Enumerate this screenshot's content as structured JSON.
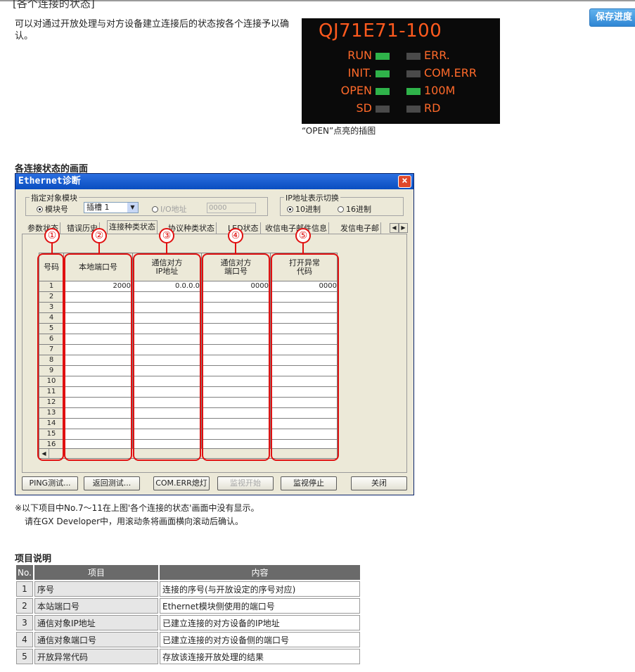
{
  "header": {
    "section_title": "[各个连接的状态]",
    "intro": "可以对通过开放处理与对方设备建立连接后的状态按各个连接予以确认。",
    "save_button": "保存进度"
  },
  "led_panel": {
    "model": "QJ71E71-100",
    "leds": [
      {
        "label": "RUN",
        "state": "on",
        "side": "left"
      },
      {
        "label": "ERR.",
        "state": "off",
        "side": "right"
      },
      {
        "label": "INIT.",
        "state": "on",
        "side": "left"
      },
      {
        "label": "COM.ERR",
        "state": "off",
        "side": "right"
      },
      {
        "label": "OPEN",
        "state": "on",
        "side": "left"
      },
      {
        "label": "100M",
        "state": "on",
        "side": "right"
      },
      {
        "label": "SD",
        "state": "off",
        "side": "left"
      },
      {
        "label": "RD",
        "state": "off",
        "side": "right"
      }
    ],
    "caption": "“OPEN”点亮的插图"
  },
  "screen_title": "各连接状态的画面",
  "dialog": {
    "title": "Ethernet诊断",
    "close": "×",
    "target_group": {
      "label": "指定对象模块",
      "radio_module": "模块号",
      "slot_value": "插槽 1",
      "radio_io": "I/O地址",
      "io_value": "0000"
    },
    "ip_group": {
      "label": "IP地址表示切换",
      "radio_dec": "10进制",
      "radio_hex": "16进制"
    },
    "tabs": [
      "参数状态",
      "错误历史",
      "连接种类状态",
      "协议种类状态",
      "LED状态",
      "收信电子邮件信息",
      "发信电子邮"
    ],
    "active_tab": 2,
    "columns": [
      {
        "header": "号码"
      },
      {
        "header": "本地端口号"
      },
      {
        "header": "通信对方\nIP地址"
      },
      {
        "header": "通信对方\n端口号"
      },
      {
        "header": "打开异常\n代码"
      }
    ],
    "rows": [
      [
        "1",
        "2000",
        "0.0.0.0",
        "0000",
        "0000"
      ],
      [
        "2",
        "",
        "",
        "",
        ""
      ],
      [
        "3",
        "",
        "",
        "",
        ""
      ],
      [
        "4",
        "",
        "",
        "",
        ""
      ],
      [
        "5",
        "",
        "",
        "",
        ""
      ],
      [
        "6",
        "",
        "",
        "",
        ""
      ],
      [
        "7",
        "",
        "",
        "",
        ""
      ],
      [
        "8",
        "",
        "",
        "",
        ""
      ],
      [
        "9",
        "",
        "",
        "",
        ""
      ],
      [
        "10",
        "",
        "",
        "",
        ""
      ],
      [
        "11",
        "",
        "",
        "",
        ""
      ],
      [
        "12",
        "",
        "",
        "",
        ""
      ],
      [
        "13",
        "",
        "",
        "",
        ""
      ],
      [
        "14",
        "",
        "",
        "",
        ""
      ],
      [
        "15",
        "",
        "",
        "",
        ""
      ],
      [
        "16",
        "",
        "",
        "",
        ""
      ]
    ],
    "callouts": [
      "①",
      "②",
      "③",
      "④",
      "⑤"
    ],
    "buttons": [
      {
        "label": "PING测试...",
        "enabled": true
      },
      {
        "label": "返回测试...",
        "enabled": true
      },
      {
        "label": "COM.ERR熄灯",
        "enabled": true
      },
      {
        "label": "监视开始",
        "enabled": false
      },
      {
        "label": "监视停止",
        "enabled": true
      },
      {
        "label": "关闭",
        "enabled": true
      }
    ]
  },
  "note": {
    "line1": "※以下项目中No.7～11在上图'各个连接的状态'画面中没有显示。",
    "line2": "请在GX Developer中，用滚动条将画面横向滚动后确认。"
  },
  "items_table": {
    "title": "项目说明",
    "headers": [
      "No.",
      "项目",
      "内容"
    ],
    "rows": [
      [
        "1",
        "序号",
        "连接的序号(与开放设定的序号对应)"
      ],
      [
        "2",
        "本站端口号",
        "Ethernet模块侧使用的端口号"
      ],
      [
        "3",
        "通信对象IP地址",
        "已建立连接的对方设备的IP地址"
      ],
      [
        "4",
        "通信对象端口号",
        "已建立连接的对方设备侧的端口号"
      ],
      [
        "5",
        "开放异常代码",
        "存放该连接开放处理的结果"
      ]
    ]
  },
  "colors": {
    "led_on": "#2fb34a",
    "led_off": "#4a4a4a",
    "led_text": "#ff6a2a",
    "callout_red": "#e01010",
    "titlebar": "#0a4ec0"
  }
}
